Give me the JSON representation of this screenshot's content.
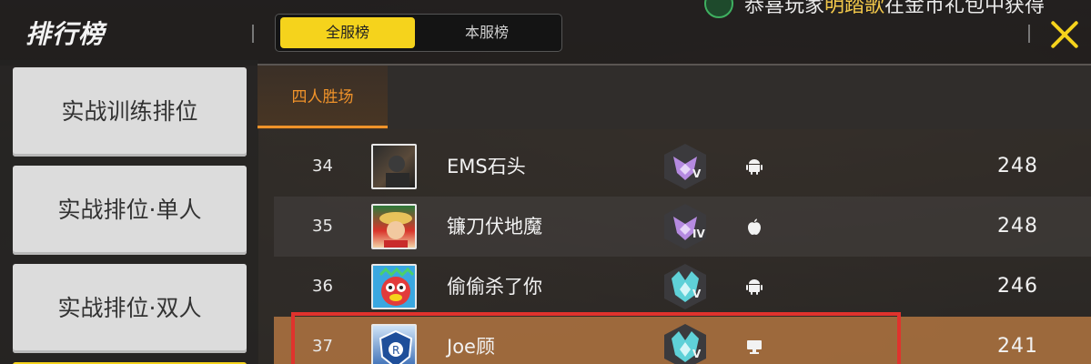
{
  "header": {
    "title": "排行榜",
    "tabs": [
      {
        "label": "全服榜",
        "active": true
      },
      {
        "label": "本服榜",
        "active": false
      }
    ],
    "broadcast": {
      "prefix": "恭喜玩家",
      "player": "明踏歌",
      "suffix": "在金币礼包中获得"
    }
  },
  "sidebar": {
    "items": [
      {
        "label": "实战训练排位"
      },
      {
        "label": "实战排位·单人"
      },
      {
        "label": "实战排位·双人"
      }
    ]
  },
  "main": {
    "subtab": "四人胜场",
    "rows": [
      {
        "rank": "34",
        "name": "EMS石头",
        "tier": "purple",
        "tier_roman": "V",
        "platform": "android-icon",
        "score": "248"
      },
      {
        "rank": "35",
        "name": "镰刀伏地魔",
        "tier": "purple",
        "tier_roman": "IV",
        "platform": "apple-icon",
        "score": "248"
      },
      {
        "rank": "36",
        "name": "偷偷杀了你",
        "tier": "cyan",
        "tier_roman": "V",
        "platform": "android-icon",
        "score": "246"
      },
      {
        "rank": "37",
        "name": "Joe顾",
        "tier": "cyan",
        "tier_roman": "V",
        "platform": "pc-icon",
        "score": "241"
      }
    ]
  },
  "colors": {
    "accent_yellow": "#f5d31c",
    "accent_orange": "#f0932a",
    "highlight_red": "#e0332d",
    "tier_purple": "#b58ae0",
    "tier_cyan": "#5fd1d8"
  }
}
